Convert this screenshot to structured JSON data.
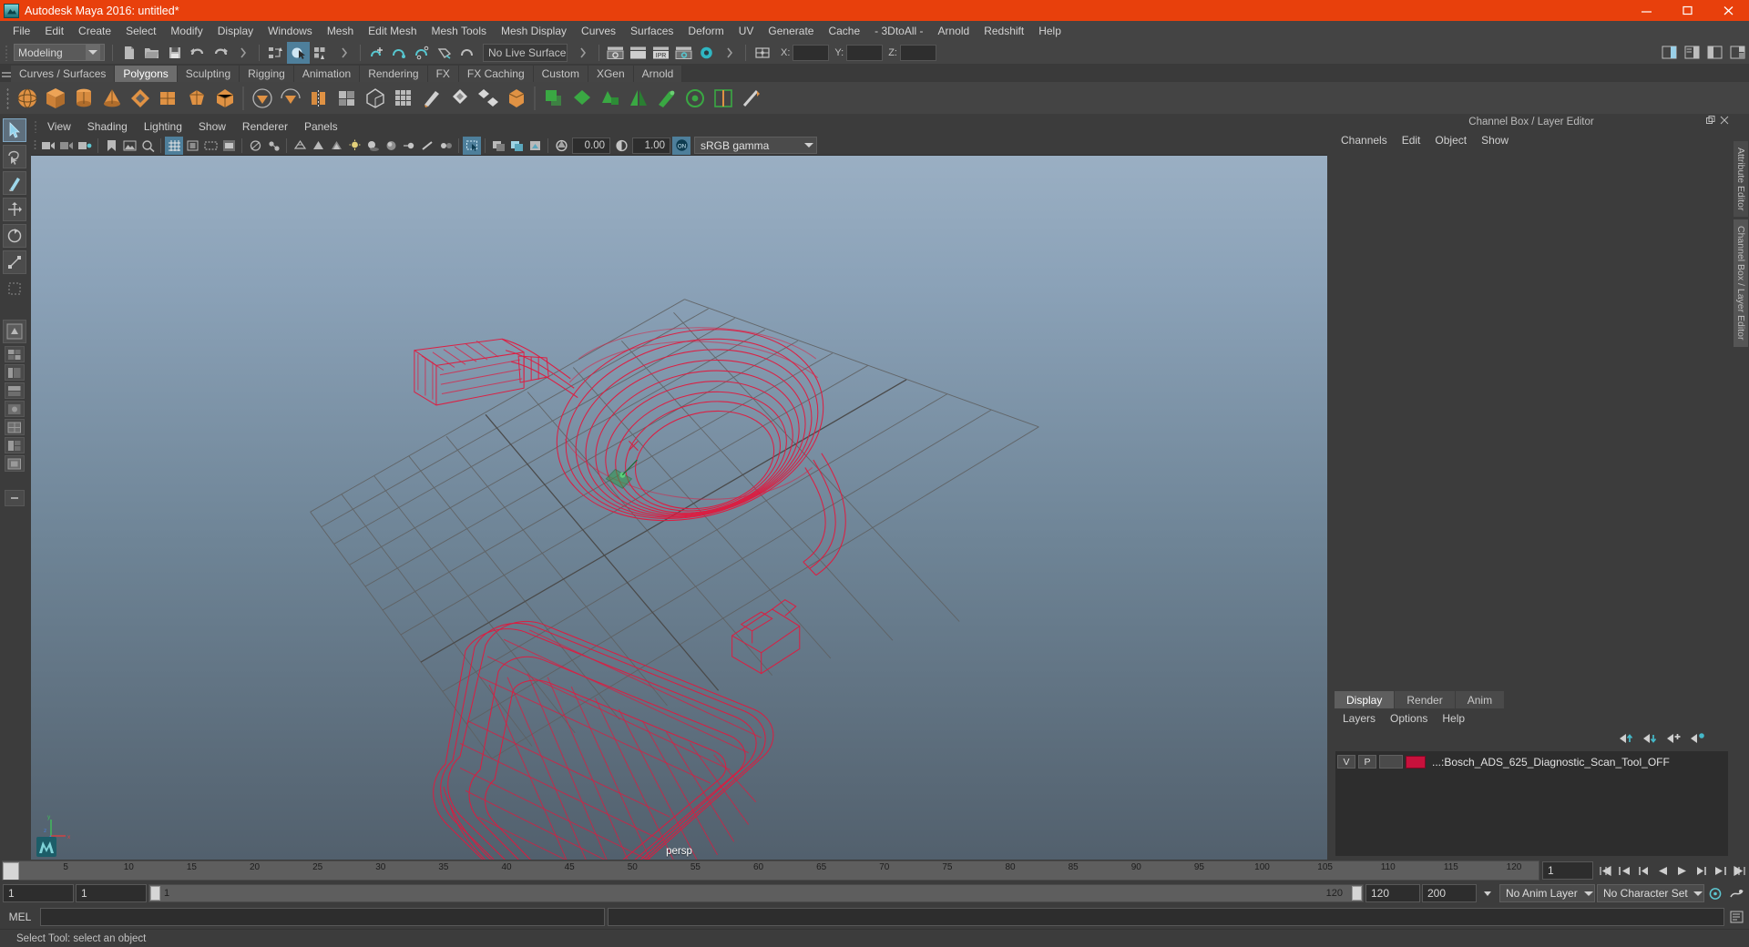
{
  "window": {
    "title": "Autodesk Maya 2016: untitled*",
    "app_icon": "maya-logo-icon",
    "controls": {
      "minimize": "minimize-icon",
      "maximize": "maximize-icon",
      "close": "close-icon"
    },
    "accent_color": "#e8400c"
  },
  "menubar": {
    "items": [
      "File",
      "Edit",
      "Create",
      "Select",
      "Modify",
      "Display",
      "Windows",
      "Mesh",
      "Edit Mesh",
      "Mesh Tools",
      "Mesh Display",
      "Curves",
      "Surfaces",
      "Deform",
      "UV",
      "Generate",
      "Cache",
      "- 3DtoAll -",
      "Arnold",
      "Redshift",
      "Help"
    ]
  },
  "status_line": {
    "menu_set": "Modeling",
    "live_surface": "No Live Surface",
    "coord_labels": {
      "x": "X:",
      "y": "Y:",
      "z": "Z:"
    },
    "coord_values": {
      "x": "",
      "y": "",
      "z": ""
    },
    "icons": [
      "new-scene-icon",
      "open-scene-icon",
      "save-scene-icon",
      "undo-icon",
      "redo-icon",
      "select-by-hierarchy-icon",
      "select-by-object-icon",
      "select-by-component-icon",
      "snap-to-grid-icon",
      "snap-to-curve-icon",
      "snap-to-point-icon",
      "snap-to-projected-center-icon",
      "snap-to-view-plane-icon",
      "make-live-icon",
      "render-current-frame-icon",
      "ipr-render-icon",
      "render-settings-icon",
      "hypershade-icon",
      "open-render-view-icon",
      "input-connections-icon",
      "output-connections-icon"
    ],
    "right_icons": [
      "show-hide-modeling-toolkit-icon",
      "show-hide-attribute-editor-icon",
      "show-hide-tool-settings-icon",
      "show-hide-channel-box-icon"
    ]
  },
  "shelf": {
    "tabs": [
      {
        "label": "Curves / Surfaces",
        "active": false
      },
      {
        "label": "Polygons",
        "active": true
      },
      {
        "label": "Sculpting",
        "active": false
      },
      {
        "label": "Rigging",
        "active": false
      },
      {
        "label": "Animation",
        "active": false
      },
      {
        "label": "Rendering",
        "active": false
      },
      {
        "label": "FX",
        "active": false
      },
      {
        "label": "FX Caching",
        "active": false
      },
      {
        "label": "Custom",
        "active": false
      },
      {
        "label": "XGen",
        "active": false
      },
      {
        "label": "Arnold",
        "active": false
      }
    ],
    "icons": [
      "polygon-sphere-icon",
      "polygon-cube-icon",
      "polygon-cylinder-icon",
      "polygon-cone-icon",
      "polygon-torus-icon",
      "polygon-plane-icon",
      "polygon-disc-icon",
      "polygon-platonic-icon",
      "polygon-pyramid-icon",
      "polygon-prism-icon",
      "polygon-pipe-icon",
      "polygon-helix-icon",
      "polygon-soccer-ball-icon",
      "polygon-super-ellipse-icon",
      "combine-icon",
      "separate-icon",
      "boolean-union-icon",
      "boolean-difference-icon",
      "boolean-intersection-icon",
      "smooth-icon",
      "extrude-icon",
      "bevel-icon",
      "bridge-icon",
      "append-polygon-icon",
      "multi-cut-icon",
      "target-weld-icon",
      "quad-draw-icon",
      "insert-edge-loop-icon",
      "offset-edge-loop-icon",
      "mirror-geometry-icon",
      "sculpt-tool-icon"
    ]
  },
  "toolbox": {
    "tools": [
      {
        "name": "select-tool",
        "active": true
      },
      {
        "name": "lasso-select-tool",
        "active": false
      },
      {
        "name": "paint-select-tool",
        "active": false
      },
      {
        "name": "move-tool",
        "active": false
      },
      {
        "name": "rotate-tool",
        "active": false
      },
      {
        "name": "scale-tool",
        "active": false
      },
      {
        "name": "last-tool-used",
        "active": false
      }
    ],
    "layout_presets": [
      "single-perspective-view-icon",
      "four-view-icon",
      "persp-outliner-icon",
      "persp-graph-editor-icon",
      "hypershade-persp-icon",
      "persp-relationship-editor-icon",
      "persp-uv-editor-icon",
      "persp-outliner-persp-icon"
    ]
  },
  "viewport": {
    "menus": [
      "View",
      "Shading",
      "Lighting",
      "Show",
      "Renderer",
      "Panels"
    ],
    "camera_label": "persp",
    "exposure_value": "0.00",
    "gamma_value": "1.00",
    "color_management": "sRGB gamma",
    "color_management_enabled": "ON",
    "axis_labels": {
      "x": "x",
      "y": "y",
      "z": "z"
    },
    "background_top": "#9aafc3",
    "background_bottom": "#52606d",
    "wireframe_color": "#e01a3f",
    "grid_color": "#5a5a5a",
    "toolbar_icons": [
      "select-camera-icon",
      "lock-camera-icon",
      "camera-attributes-icon",
      "bookmarks-icon",
      "image-plane-icon",
      "two-d-pan-zoom-icon",
      "grid-toggle-icon",
      "film-gate-icon",
      "resolution-gate-icon",
      "gate-mask-icon",
      "xray-toggle-icon",
      "xray-joints-icon",
      "wireframe-icon",
      "smooth-shade-all-icon",
      "smooth-shade-textured-icon",
      "use-all-lights-icon",
      "shadows-icon",
      "screen-space-ao-icon",
      "motion-blur-icon",
      "multisample-aa-icon",
      "depth-of-field-icon",
      "isolate-select-icon",
      "xray-mode-icon",
      "display-textures-icon",
      "exposure-icon",
      "gamma-icon",
      "color-management-icon"
    ]
  },
  "channel_box": {
    "panel_title": "Channel Box / Layer Editor",
    "menus": [
      "Channels",
      "Edit",
      "Object",
      "Show"
    ],
    "float_icon": "float-panel-icon",
    "close_icon": "close-panel-icon"
  },
  "layer_editor": {
    "tabs": [
      {
        "label": "Display",
        "active": true
      },
      {
        "label": "Render",
        "active": false
      },
      {
        "label": "Anim",
        "active": false
      }
    ],
    "menus": [
      "Layers",
      "Options",
      "Help"
    ],
    "buttons": [
      "move-layer-up-icon",
      "move-layer-down-icon",
      "new-layer-icon",
      "new-layer-from-selected-icon"
    ],
    "layers": [
      {
        "visibility": "V",
        "playback": "P",
        "shading": "",
        "color": "#c8113c",
        "name": "...:Bosch_ADS_625_Diagnostic_Scan_Tool_OFF"
      }
    ]
  },
  "side_tabs": [
    "Attribute Editor",
    "Channel Box / Layer Editor"
  ],
  "time_slider": {
    "ticks": [
      "5",
      "10",
      "15",
      "20",
      "25",
      "30",
      "35",
      "40",
      "45",
      "50",
      "55",
      "60",
      "65",
      "70",
      "75",
      "80",
      "85",
      "90",
      "95",
      "100",
      "105",
      "110",
      "115",
      "120"
    ],
    "current_frame_left": "1",
    "current_frame_right": "1",
    "playback_buttons": [
      "go-to-start-icon",
      "step-back-frame-icon",
      "step-back-key-icon",
      "play-backwards-icon",
      "play-forwards-icon",
      "step-forward-key-icon",
      "step-forward-frame-icon",
      "go-to-end-icon"
    ]
  },
  "range_slider": {
    "anim_start": "1",
    "range_start": "1",
    "range_bar_start_label": "1",
    "range_bar_end_label": "120",
    "range_end": "120",
    "anim_end": "200",
    "anim_layer": "No Anim Layer",
    "character_set": "No Character Set",
    "auto_key_icon": "auto-keyframe-icon",
    "anim_prefs_icon": "animation-preferences-icon"
  },
  "command_line": {
    "label": "MEL",
    "input_value": "",
    "output_value": "",
    "script_editor_icon": "script-editor-icon"
  },
  "help_line": {
    "text": "Select Tool: select an object"
  }
}
